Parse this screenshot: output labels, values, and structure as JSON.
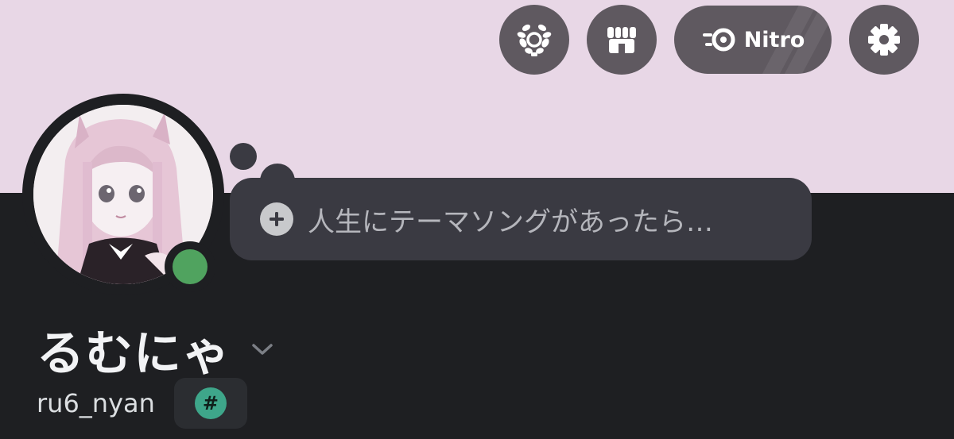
{
  "colors": {
    "banner": "#e8d7e6",
    "background": "#1e1f22",
    "header_button": "#5f5960",
    "bubble": "#3a3a42",
    "status_online": "#50a35f",
    "tag_badge_accent": "#3ea68a"
  },
  "header": {
    "buttons": [
      {
        "icon": "laurel-badge-icon"
      },
      {
        "icon": "shop-icon"
      },
      {
        "icon": "nitro-icon",
        "label": "Nitro"
      },
      {
        "icon": "gear-icon"
      }
    ]
  },
  "profile": {
    "avatar": {
      "icon": "anime-avatar",
      "status": "online"
    },
    "status_bubble": {
      "placeholder": "人生にテーマソングがあったら…",
      "icon": "plus-icon"
    },
    "display_name": "るむにゃ",
    "username": "ru6_nyan",
    "tag_badge": {
      "symbol": "#"
    }
  }
}
